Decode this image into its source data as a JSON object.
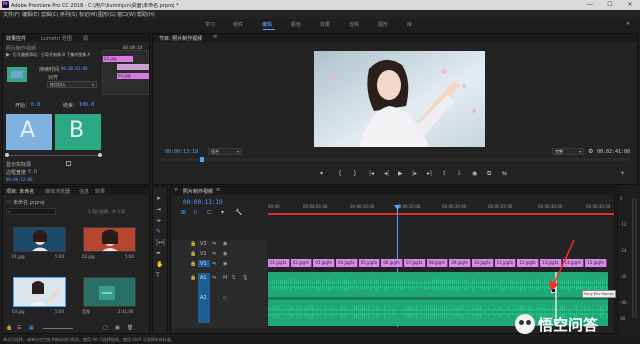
{
  "window": {
    "title": "Adobe Premiere Pro CC 2018 - C:\\用户\\liuminjun\\桌面\\未命名.prproj *",
    "controls": [
      "—",
      "☐",
      "✕"
    ]
  },
  "menu": [
    "文件(F)",
    "编辑(E)",
    "剪辑(C)",
    "序列(S)",
    "标记(M)",
    "图形(G)",
    "窗口(W)",
    "帮助(H)"
  ],
  "workspaces": [
    {
      "label": "学习",
      "active": false
    },
    {
      "label": "组件",
      "active": false
    },
    {
      "label": "编辑",
      "active": true
    },
    {
      "label": "颜色",
      "active": false
    },
    {
      "label": "效果",
      "active": false
    },
    {
      "label": "音频",
      "active": false
    },
    {
      "label": "图形",
      "active": false
    },
    {
      "label": "库",
      "active": false
    }
  ],
  "effect_controls": {
    "tabs": [
      "效果控件",
      "Lumetri 范围",
      "源"
    ],
    "time_top": "00:00:10",
    "sequence_label": "照片制作视频",
    "transition_title": "打开圆圈滑动：引导开始像 B 下集的图像 A",
    "clip_a": "02.jpg",
    "clip_b": "03.jpg",
    "duration_label": "持续时间",
    "duration_value": "00:00:01:00",
    "align_label": "对齐",
    "align_value": "终点切入",
    "start_label": "开始：",
    "start_value": "0.0",
    "end_label": "结束：",
    "end_value": "100.0",
    "preview_a": "A",
    "preview_b": "B",
    "show_actual_label": "显示实际源",
    "border_width_label": "边框宽度",
    "border_width_value": "0.0",
    "time_bottom": "00:00:12:06"
  },
  "program": {
    "title": "节目: 照片制作视频",
    "timecode": "00:00:13:19",
    "fit": "适合",
    "quality": "完整",
    "duration": "00:02:41:06"
  },
  "project": {
    "tabs": [
      "项目: 未命名",
      "媒体浏览器",
      "信息",
      "效果"
    ],
    "file": "未命名.prproj",
    "search_placeholder": "",
    "item_count": "1 项已选择，共 3 项",
    "items": [
      {
        "name": "01.jpg",
        "dur": "5:00"
      },
      {
        "name": "02.jpg",
        "dur": "5:00"
      },
      {
        "name": "03.jpg",
        "dur": "5:00"
      },
      {
        "name": "音频",
        "dur": "2:41:06"
      }
    ]
  },
  "timeline": {
    "title": "照片制作视频",
    "timecode": "00:00:13:19",
    "ruler_ticks": [
      "00:00",
      "00:00:05:00",
      "00:00:10:00",
      "00:00:15:00",
      "00:00:20:00",
      "00:00:25:00",
      "00:00:30:00",
      "00:00:35:00"
    ],
    "tracks": [
      {
        "id": "V3",
        "type": "video"
      },
      {
        "id": "V2",
        "type": "video"
      },
      {
        "id": "V1",
        "type": "video"
      },
      {
        "id": "A1",
        "type": "audio"
      },
      {
        "id": "A2",
        "type": "audio"
      }
    ],
    "clips": [
      "01.jpg",
      "02.jpg",
      "03.jpg",
      "04.jpg",
      "05.jpg",
      "06.jpg",
      "07.jpg",
      "08.jpg",
      "09.jpg",
      "10.jpg",
      "11.jpg",
      "12.jpg",
      "13.jpg",
      "14.jpg",
      "15.jpg"
    ],
    "db_scale": [
      "0",
      "-12",
      "-24",
      "-36",
      "-48",
      "dB"
    ],
    "keyframe_tooltip": "Sony Eric Haman",
    "watermark": "悟空问答"
  },
  "status": {
    "text": "单击可选择，或单击空白处并拖动进行框选。使用 Alt 可选择链接。使用 Shift 可选择所有轨道。"
  },
  "colors": {
    "accent_blue": "#4aa3ff",
    "clip_pink": "#d88be4",
    "audio_green": "#22b576",
    "playhead_red": "#d93030"
  }
}
